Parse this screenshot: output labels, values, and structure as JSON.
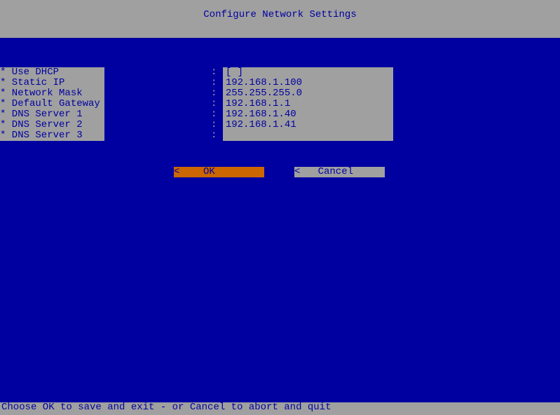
{
  "title": "Configure Network Settings",
  "fields": [
    {
      "label": "* Use DHCP",
      "value": "[ ]"
    },
    {
      "label": "* Static IP",
      "value": "192.168.1.100"
    },
    {
      "label": "* Network Mask",
      "value": "255.255.255.0"
    },
    {
      "label": "* Default Gateway",
      "value": "192.168.1.1"
    },
    {
      "label": "* DNS Server 1",
      "value": "192.168.1.40"
    },
    {
      "label": "* DNS Server 2",
      "value": "192.168.1.41"
    },
    {
      "label": "* DNS Server 3",
      "value": ""
    }
  ],
  "buttons": {
    "ok": "<    OK           >",
    "cancel": "<   Cancel        >"
  },
  "status": "Choose OK to save and exit - or Cancel to abort and quit"
}
